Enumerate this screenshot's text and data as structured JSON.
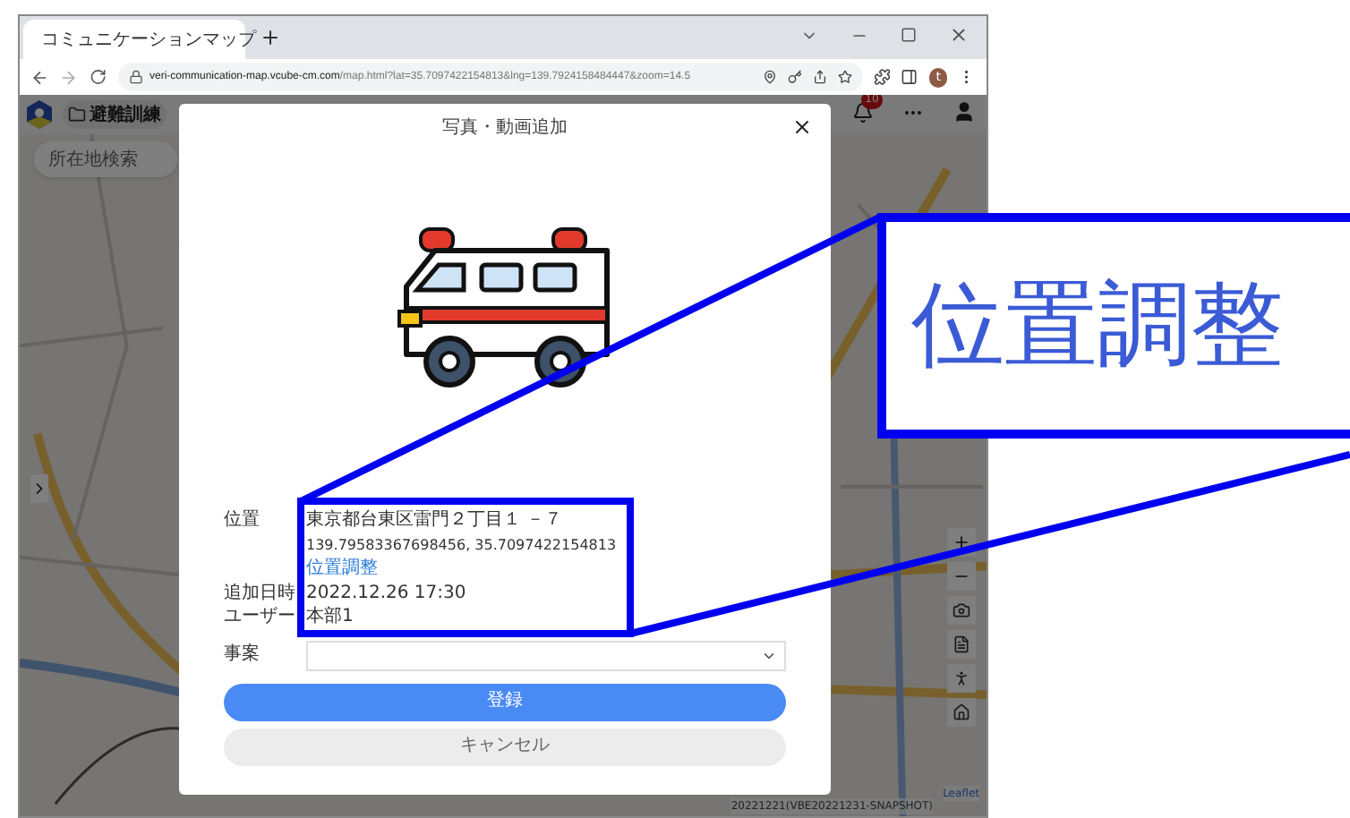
{
  "browser": {
    "tab": {
      "title": "コミュニケーションマップ"
    },
    "url_host": "veri-communication-map.vcube-cm.com",
    "url_path": "/map.html?lat=35.7097422154813&lng=139.7924158484447&zoom=14.5",
    "avatar": "t"
  },
  "app": {
    "folder": "避難訓練",
    "notification_count": "10",
    "search": {
      "placeholder": "所在地検索"
    }
  },
  "map": {
    "attribution": "20221221(VBE20221231-SNAPSHOT)",
    "credit": "Leaflet"
  },
  "dialog": {
    "title": "写真・動画追加",
    "location": {
      "label": "位置",
      "address": "東京都台東区雷門２丁目１ －７",
      "coordinates": "139.79583367698456, 35.7097422154813",
      "adjust_link": "位置調整"
    },
    "rows": [
      {
        "label": "追加日時",
        "value": "2022.12.26 17:30"
      },
      {
        "label": "ユーザー",
        "value": "本部1"
      }
    ],
    "incident": {
      "label": "事案"
    },
    "buttons": [
      {
        "label": "登録",
        "kind": "primary"
      },
      {
        "label": "キャンセル",
        "kind": "secondary"
      }
    ]
  },
  "callout": {
    "text": "位置調整"
  }
}
